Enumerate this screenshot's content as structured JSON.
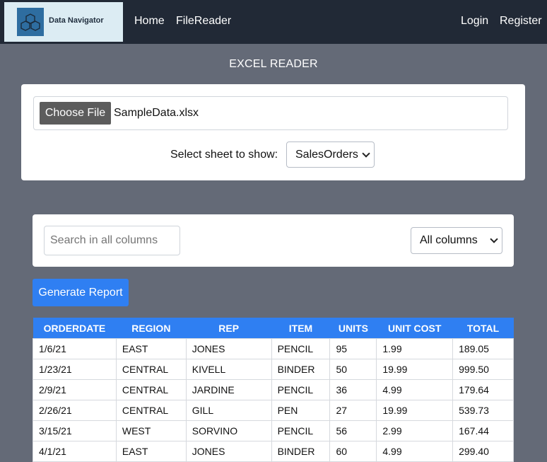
{
  "navbar": {
    "logo_text": "Data Navigator",
    "home": "Home",
    "filereader": "FileReader",
    "login": "Login",
    "register": "Register"
  },
  "page_title": "EXCEL READER",
  "file_picker": {
    "button_label": "Choose File",
    "file_name": "SampleData.xlsx"
  },
  "sheet": {
    "label": "Select sheet to show:",
    "selected": "SalesOrders"
  },
  "filter": {
    "search_placeholder": "Search in all columns",
    "column_selected": "All columns"
  },
  "generate_report_label": "Generate Report",
  "table": {
    "headers": [
      "ORDERDATE",
      "REGION",
      "REP",
      "ITEM",
      "UNITS",
      "UNIT COST",
      "TOTAL"
    ],
    "rows": [
      [
        "1/6/21",
        "EAST",
        "JONES",
        "PENCIL",
        "95",
        "1.99",
        "189.05"
      ],
      [
        "1/23/21",
        "CENTRAL",
        "KIVELL",
        "BINDER",
        "50",
        "19.99",
        "999.50"
      ],
      [
        "2/9/21",
        "CENTRAL",
        "JARDINE",
        "PENCIL",
        "36",
        "4.99",
        "179.64"
      ],
      [
        "2/26/21",
        "CENTRAL",
        "GILL",
        "PEN",
        "27",
        "19.99",
        "539.73"
      ],
      [
        "3/15/21",
        "WEST",
        "SORVINO",
        "PENCIL",
        "56",
        "2.99",
        "167.44"
      ],
      [
        "4/1/21",
        "EAST",
        "JONES",
        "BINDER",
        "60",
        "4.99",
        "299.40"
      ]
    ]
  },
  "colors": {
    "navbar": "#212936",
    "page_background": "#646a77",
    "accent": "#2f7ff2"
  }
}
